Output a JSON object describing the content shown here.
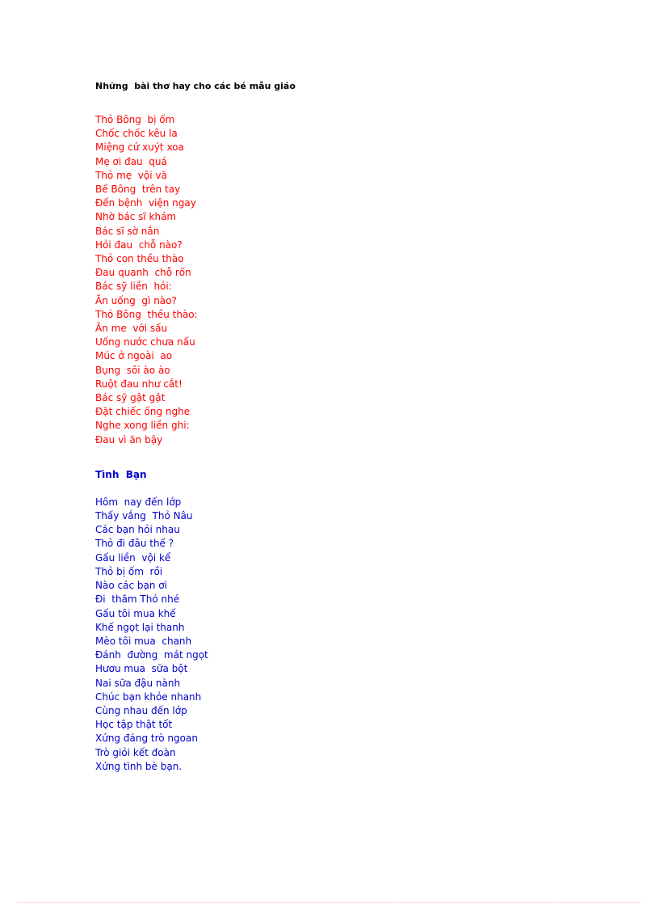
{
  "document": {
    "title": "Những  bài thơ hay cho các bé mẫu giáo",
    "colors": {
      "title": "#000000",
      "poem_one": "#ff0000",
      "poem_two": "#0000cc",
      "footer_rule": "#ffb3d9",
      "page_background": "#ffffff"
    },
    "poems": [
      {
        "heading": "Thỏ Bông bị ốm",
        "heading_shown_as_first_line": true,
        "color": "#ff0000",
        "lines": [
          "Thỏ Bông  bị ốm",
          "Chốc chốc kêu la",
          "Miệng cứ xuýt xoa",
          "Mẹ ơi đau  quá",
          "Thỏ mẹ  vội vã",
          "Bế Bông  trên tay",
          "Đến bệnh  viện ngay",
          "Nhờ bác sĩ khám",
          "Bác sĩ sờ nắn",
          "Hỏi đau  chỗ nào?",
          "Thỏ con thều thào",
          "Đau quanh  chỗ rốn",
          "Bác sỹ liền  hỏi:",
          "Ăn uống  gì nào?",
          "Thỏ Bông  thều thào:",
          "Ăn me  với sấu",
          "Uống nước chưa nấu",
          "Múc ở ngoài  ao",
          "Bụng  sôi ào ào",
          "Ruột đau như cắt!",
          "Bác sỹ gật gật",
          "Đặt chiếc ống nghe",
          "Nghe xong liền ghi:",
          "Đau vì ăn bậy"
        ]
      },
      {
        "heading": "Tình  Bạn",
        "heading_shown_as_first_line": false,
        "color": "#0000cc",
        "lines": [
          "Hôm  nay đến lớp",
          "Thấy vắng  Thỏ Nâu",
          "Các bạn hỏi nhau",
          "Thỏ đi đâu thế ?",
          "Gấu liền  vội kể",
          "Thỏ bị ốm  rồi",
          "Nào các bạn ơi",
          "Đi  thăm Thỏ nhé",
          "Gấu tôi mua khế",
          "Khế ngọt lại thanh",
          "Mèo tôi mua  chanh",
          "Đánh  đường  mát ngọt",
          "Hươu mua  sữa bột",
          "Nai sữa đậu nành",
          "Chúc bạn khỏe nhanh",
          "Cùng nhau đến lớp",
          "Học tập thật tốt",
          "Xứng đáng trò ngoan",
          "Trò giỏi kết đoàn",
          "Xứng tình bè bạn."
        ]
      }
    ]
  }
}
